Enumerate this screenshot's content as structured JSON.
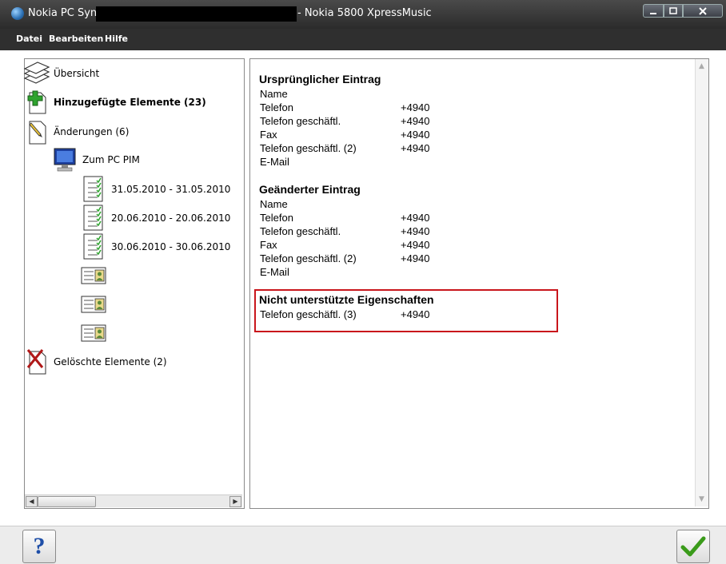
{
  "window": {
    "app_name": "Nokia PC Sync",
    "device_suffix": "- Nokia 5800 XpressMusic"
  },
  "menu": {
    "file": "Datei",
    "edit": "Bearbeiten",
    "help": "Hilfe"
  },
  "tree": {
    "overview": "Übersicht",
    "added": "Hinzugefügte Elemente (23)",
    "changes": "Änderungen (6)",
    "to_pc_pim": "Zum PC PIM",
    "entry_1": "31.05.2010 - 31.05.2010",
    "entry_2": "20.06.2010 - 20.06.2010",
    "entry_3": "30.06.2010 - 30.06.2010",
    "deleted": "Gelöschte Elemente (2)"
  },
  "details": {
    "original": {
      "heading": "Ursprünglicher Eintrag",
      "rows": [
        {
          "label": "Name",
          "value": ""
        },
        {
          "label": "Telefon",
          "value": "+4940"
        },
        {
          "label": "Telefon geschäftl.",
          "value": "+4940"
        },
        {
          "label": "Fax",
          "value": "+4940"
        },
        {
          "label": "Telefon geschäftl. (2)",
          "value": "+4940"
        },
        {
          "label": "E-Mail",
          "value": ""
        }
      ]
    },
    "changed": {
      "heading": "Geänderter Eintrag",
      "rows": [
        {
          "label": "Name",
          "value": ""
        },
        {
          "label": "Telefon",
          "value": "+4940"
        },
        {
          "label": "Telefon geschäftl.",
          "value": "+4940"
        },
        {
          "label": "Fax",
          "value": "+4940"
        },
        {
          "label": "Telefon geschäftl. (2)",
          "value": "+4940"
        },
        {
          "label": "E-Mail",
          "value": ""
        }
      ]
    },
    "unsupported": {
      "heading": "Nicht unterstützte Eigenschaften",
      "rows": [
        {
          "label": "Telefon geschäftl. (3)",
          "value": "+4940"
        }
      ]
    }
  },
  "buttons": {
    "help_symbol": "?"
  },
  "colors": {
    "highlight_border": "#c9161c",
    "titlebar": "#3a3a3a",
    "check_green": "#3a9b1a"
  }
}
